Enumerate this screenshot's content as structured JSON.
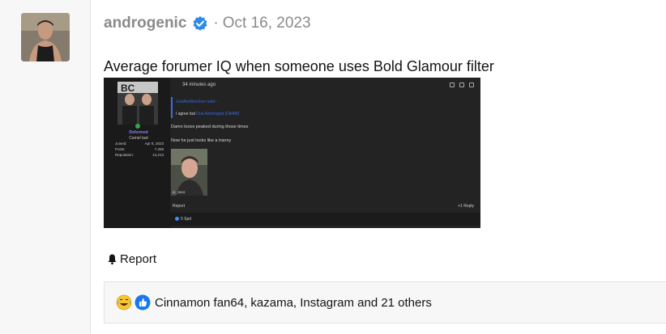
{
  "post": {
    "username": "androgenic",
    "separator": "·",
    "date": "Oct 16, 2023",
    "text": "Average forumer IQ when someone uses Bold Glamour filter",
    "report_label": "Report"
  },
  "reactions": {
    "summary": "Cinnamon fan64, kazama, Instagram and 21 others",
    "icons": [
      "laughing-crying-emoji-icon",
      "thumbs-up-like-icon"
    ]
  },
  "embedded_screenshot": {
    "time": "34 minutes ago",
    "user_role": "Reformed",
    "user_sub": "Camel last",
    "stats": [
      {
        "label": "Joined:",
        "value": "Apr 8, 2023"
      },
      {
        "label": "Posts:",
        "value": "7,268"
      },
      {
        "label": "Reputation:",
        "value": "14,213"
      }
    ],
    "quote_header": "JustAnotherUser said: ↑",
    "quote_text": "I agree but",
    "quote_link": "Dua Adonisgod (DAAM)",
    "line1": "Damn looox peaked during those times",
    "line2": "Now he just looks like a tranny",
    "photo_caption": "IC_ 05:03",
    "report": "Report",
    "right_actions": "+1   Reply",
    "reaction": "5 Spd"
  },
  "colors": {
    "verified_badge": "#2f8ae5",
    "muted_text": "#8a8a8a",
    "gutter_bg": "#f7f7f7"
  }
}
